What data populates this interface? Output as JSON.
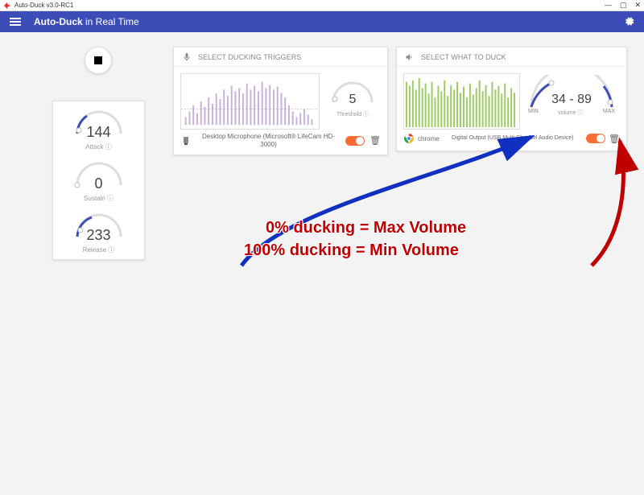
{
  "window": {
    "title": "Auto-Duck v3.0-RC1"
  },
  "appbar": {
    "title_bold": "Auto-Duck",
    "title_light": " in Real Time"
  },
  "gauges": {
    "attack": {
      "value": "144",
      "label": "Attack ⓘ"
    },
    "sustain": {
      "value": "0",
      "label": "Sustain ⓘ"
    },
    "release": {
      "value": "233",
      "label": "Release ⓘ"
    }
  },
  "trigger": {
    "header": "SELECT DUCKING TRIGGERS",
    "threshold_value": "5",
    "threshold_label": "Threshold ⓘ",
    "device": "Desktop Microphone (Microsoft® LifeCam HD-3000)"
  },
  "duck": {
    "header": "SELECT WHAT TO DUCK",
    "value": "34 - 89",
    "min_label": "MIN",
    "max_label": "MAX",
    "volume_label": "volume ⓘ",
    "app_name": "chrome",
    "device": "Digital Output (USB Multi-Channel Audio Device)"
  },
  "annotations": {
    "line1": "0% ducking = Max Volume",
    "line2": "100% ducking = Min  Volume"
  }
}
